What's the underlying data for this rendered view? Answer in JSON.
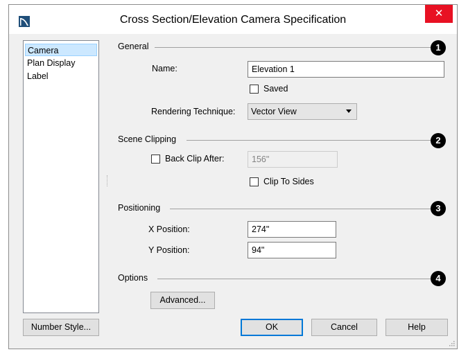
{
  "window": {
    "title": "Cross Section/Elevation Camera Specification",
    "close_label": "✕"
  },
  "sidebar": {
    "items": [
      {
        "label": "Camera",
        "selected": true
      },
      {
        "label": "Plan Display",
        "selected": false
      },
      {
        "label": "Label",
        "selected": false
      }
    ]
  },
  "sections": {
    "general": {
      "label": "General",
      "badge": "1"
    },
    "scene_clipping": {
      "label": "Scene Clipping",
      "badge": "2"
    },
    "positioning": {
      "label": "Positioning",
      "badge": "3"
    },
    "options": {
      "label": "Options",
      "badge": "4"
    }
  },
  "general": {
    "name_label": "Name:",
    "name_value": "Elevation 1",
    "saved_label": "Saved",
    "saved_checked": false,
    "rendering_label": "Rendering Technique:",
    "rendering_value": "Vector View"
  },
  "scene_clipping": {
    "back_clip_label": "Back Clip After:",
    "back_clip_checked": false,
    "back_clip_value": "156\"",
    "clip_sides_label": "Clip To Sides",
    "clip_sides_checked": false
  },
  "positioning": {
    "x_label": "X Position:",
    "x_value": "274\"",
    "y_label": "Y Position:",
    "y_value": "94\""
  },
  "options": {
    "advanced_label": "Advanced..."
  },
  "footer": {
    "number_style_label": "Number Style...",
    "ok_label": "OK",
    "cancel_label": "Cancel",
    "help_label": "Help"
  },
  "colors": {
    "accent": "#0078d7",
    "close": "#e81123",
    "selection": "#cce8ff"
  }
}
